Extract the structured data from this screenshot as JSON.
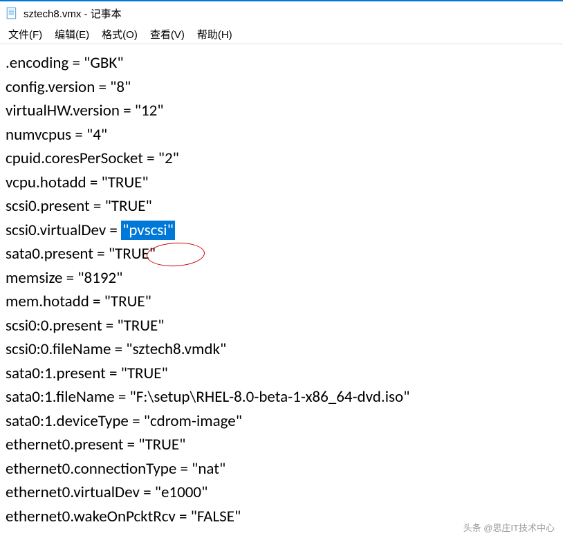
{
  "window": {
    "title": "sztech8.vmx - 记事本"
  },
  "menu": {
    "file": "文件(F)",
    "edit": "编辑(E)",
    "format": "格式(O)",
    "view": "查看(V)",
    "help": "帮助(H)"
  },
  "content": {
    "lines": [
      ".encoding = \"GBK\"",
      "config.version = \"8\"",
      "virtualHW.version = \"12\"",
      "numvcpus = \"4\"",
      "cpuid.coresPerSocket = \"2\"",
      "vcpu.hotadd = \"TRUE\"",
      "scsi0.present = \"TRUE\"",
      "scsi0.virtualDev = ",
      "sata0.present = \"TRUE\"",
      "memsize = \"8192\"",
      "mem.hotadd = \"TRUE\"",
      "scsi0:0.present = \"TRUE\"",
      "scsi0:0.fileName = \"sztech8.vmdk\"",
      "sata0:1.present = \"TRUE\"",
      "sata0:1.fileName = \"F:\\setup\\RHEL-8.0-beta-1-x86_64-dvd.iso\"",
      "sata0:1.deviceType = \"cdrom-image\"",
      "ethernet0.present = \"TRUE\"",
      "ethernet0.connectionType = \"nat\"",
      "ethernet0.virtualDev = \"e1000\"",
      "ethernet0.wakeOnPcktRcv = \"FALSE\""
    ],
    "highlighted_value": "\"pvscsi\""
  },
  "watermark": "头条 @思庄IT技术中心"
}
